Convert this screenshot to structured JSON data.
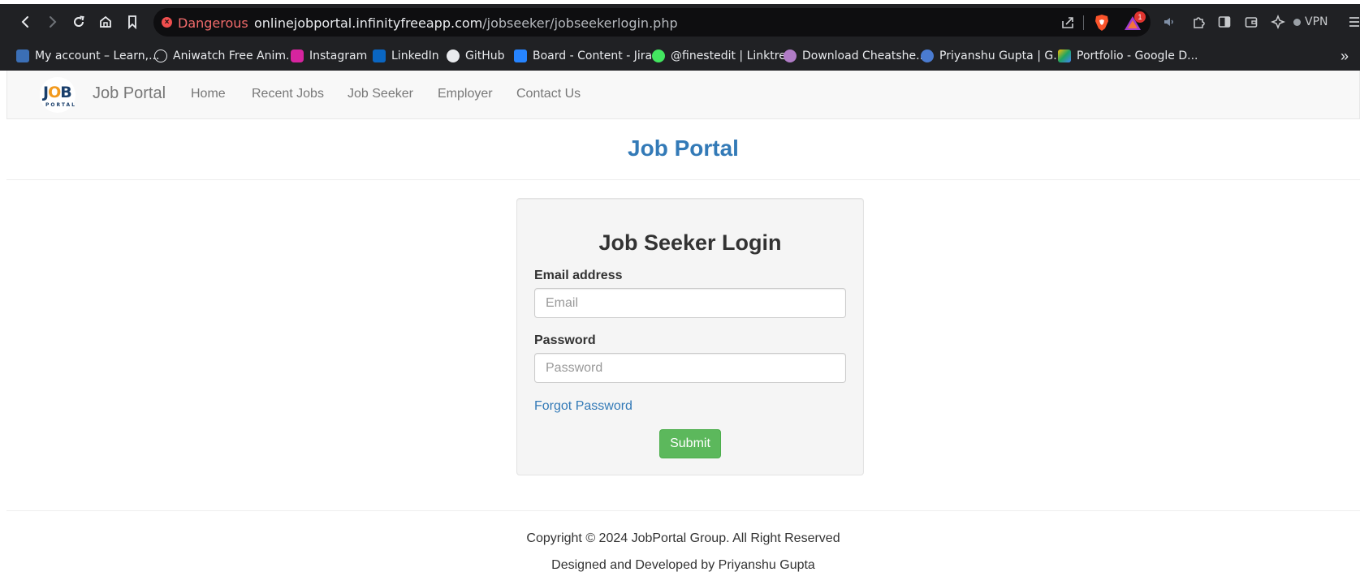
{
  "browser": {
    "security_label": "Dangerous",
    "url_host": "onlinejobportal.infinityfreeapp.com",
    "url_path": "/jobseeker/jobseekerlogin.php",
    "rewards_badge": "1",
    "vpn_label": "VPN",
    "bookmarks": [
      {
        "label": "My account – Learn,...",
        "color": "#3b6fb6"
      },
      {
        "label": "Aniwatch Free Anim...",
        "color": "#202124"
      },
      {
        "label": "Instagram",
        "color": "#d6249f"
      },
      {
        "label": "LinkedIn",
        "color": "#0a66c2"
      },
      {
        "label": "GitHub",
        "color": "#202124"
      },
      {
        "label": "Board - Content - Jira",
        "color": "#2684ff"
      },
      {
        "label": "@finestedit | Linktree",
        "color": "#43e660"
      },
      {
        "label": "Download Cheatshe...",
        "color": "#b07cc6"
      },
      {
        "label": "Priyanshu Gupta | G...",
        "color": "#4a7bd0"
      },
      {
        "label": "Portfolio - Google D...",
        "color": "#1fa463"
      }
    ]
  },
  "navbar": {
    "logo_top_a": "J",
    "logo_top_o": "O",
    "logo_top_b": "B",
    "logo_bottom": "PORTAL",
    "brand": "Job Portal",
    "links": [
      "Home",
      "Recent Jobs",
      "Job Seeker",
      "Employer",
      "Contact Us"
    ]
  },
  "page_title": "Job Portal",
  "login": {
    "title": "Job Seeker Login",
    "email_label": "Email address",
    "email_placeholder": "Email",
    "email_value": "",
    "password_label": "Password",
    "password_placeholder": "Password",
    "password_value": "",
    "forgot_label": "Forgot Password",
    "submit_label": "Submit"
  },
  "footer": {
    "copyright": "Copyright © 2024 JobPortal Group. All Right Reserved",
    "credit": "Designed and Developed by Priyanshu Gupta"
  },
  "colors": {
    "link": "#337ab7",
    "submit_bg": "#5cb85c",
    "danger": "#f26b6b"
  }
}
